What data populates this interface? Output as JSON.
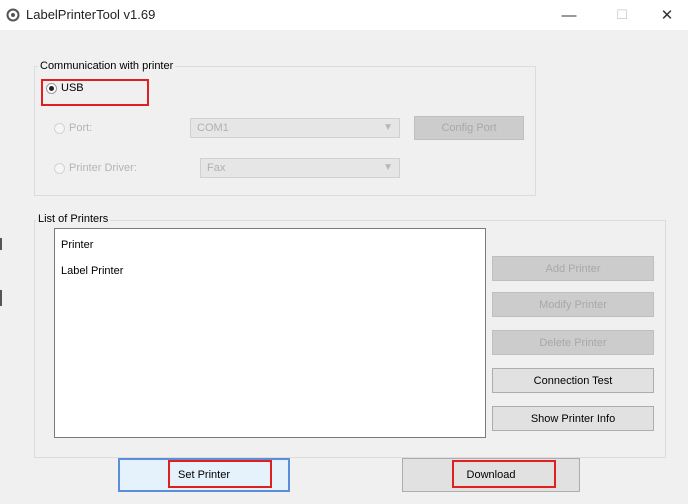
{
  "window": {
    "title": "LabelPrinterTool v1.69",
    "minimize_glyph": "—",
    "maximize_glyph": "☐",
    "close_glyph": "✕"
  },
  "communication": {
    "group_label": "Communication with printer",
    "usb_label": "USB",
    "port_label": "Port:",
    "port_value": "COM1",
    "config_port_label": "Config Port",
    "printer_driver_label": "Printer Driver:",
    "printer_driver_value": "Fax"
  },
  "printers": {
    "group_label": "List of Printers",
    "items": [
      "Printer",
      "Label Printer"
    ],
    "add_printer_label": "Add Printer",
    "modify_printer_label": "Modify Printer",
    "delete_printer_label": "Delete Printer",
    "connection_test_label": "Connection Test",
    "show_printer_info_label": "Show Printer Info"
  },
  "footer": {
    "set_printer_label": "Set Printer",
    "download_label": "Download"
  },
  "icons": {
    "app": "gear-icon",
    "dropdown": "chevron-down-icon"
  },
  "colors": {
    "highlight": "#e02020",
    "focus_border": "#5a8ed8"
  }
}
